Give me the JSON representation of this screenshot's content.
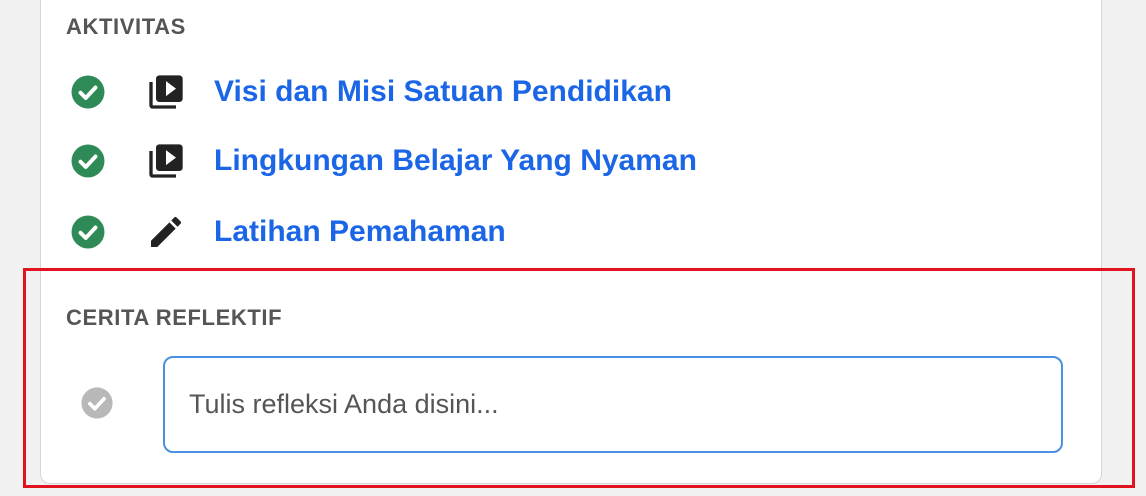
{
  "activities_section": {
    "title": "AKTIVITAS",
    "items": [
      {
        "label": "Visi dan Misi Satuan Pendidikan",
        "type_icon": "video-library-icon",
        "status": "completed"
      },
      {
        "label": "Lingkungan Belajar Yang Nyaman",
        "type_icon": "video-library-icon",
        "status": "completed"
      },
      {
        "label": "Latihan Pemahaman",
        "type_icon": "pencil-icon",
        "status": "completed"
      }
    ]
  },
  "reflection_section": {
    "title": "CERITA REFLEKTIF",
    "status": "incomplete",
    "input_value": "",
    "input_placeholder": "Tulis refleksi Anda disini..."
  },
  "colors": {
    "link": "#1a66e6",
    "check_done": "#2e8b57",
    "check_pending": "#b8b8b8",
    "input_border": "#4a90e2",
    "highlight": "#e0141e",
    "section_title": "#555555"
  }
}
